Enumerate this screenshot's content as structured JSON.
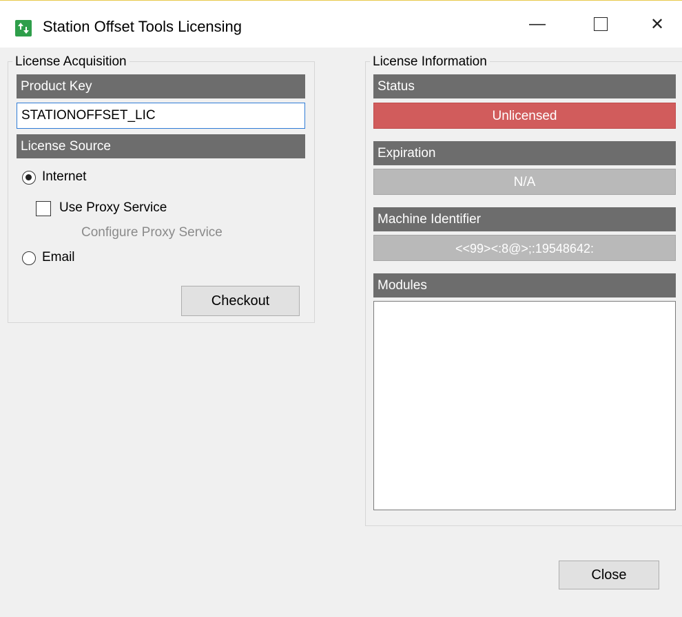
{
  "window": {
    "title": "Station Offset Tools Licensing",
    "minimize_glyph": "—",
    "close_glyph": "✕"
  },
  "acquisition": {
    "group_label": "License Acquisition",
    "product_key_header": "Product Key",
    "product_key_value": "STATIONOFFSET_LIC",
    "license_source_header": "License Source",
    "internet_label": "Internet",
    "internet_selected": true,
    "use_proxy_label": "Use Proxy Service",
    "use_proxy_checked": false,
    "configure_proxy_label": "Configure Proxy Service",
    "email_label": "Email",
    "email_selected": false,
    "checkout_label": "Checkout"
  },
  "information": {
    "group_label": "License Information",
    "status_header": "Status",
    "status_value": "Unlicensed",
    "expiration_header": "Expiration",
    "expiration_value": "N/A",
    "machine_id_header": "Machine Identifier",
    "machine_id_value": "<<99><:8@>;:19548642:",
    "modules_header": "Modules",
    "modules": []
  },
  "footer": {
    "close_label": "Close"
  },
  "colors": {
    "header_bg": "#6d6d6d",
    "status_unlicensed": "#d15c5c",
    "readonly_bg": "#b9b9b9",
    "input_border": "#2e7bd6",
    "window_bg": "#f0f0f0"
  },
  "icons": {
    "app": "app-icon",
    "minimize": "minimize-icon",
    "maximize": "maximize-icon",
    "close": "close-icon"
  }
}
